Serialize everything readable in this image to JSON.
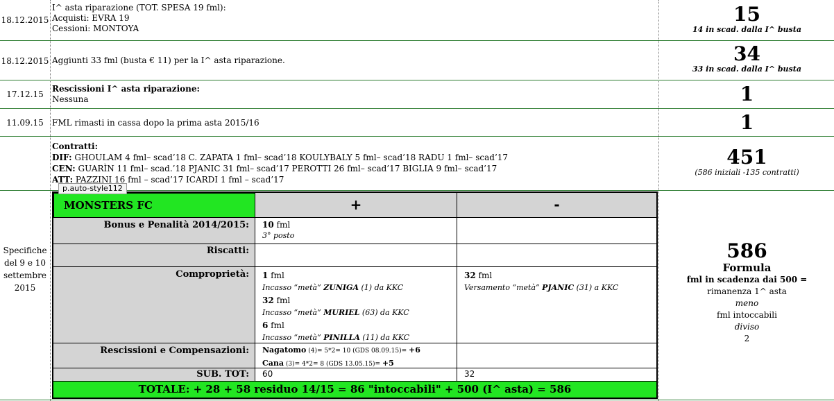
{
  "rows": [
    {
      "date": "18.12.2015",
      "lines": [
        "I^ asta riparazione (TOT. SPESA 19 fml):",
        "Acquisti: EVRA 19",
        "Cessioni: MONTOYA"
      ],
      "value": "15",
      "note": "14 in scad. dalla I^ busta"
    },
    {
      "date": "18.12.2015",
      "lines": [
        "Aggiunti 33 fml (busta € 11) per la I^ asta riparazione."
      ],
      "value": "34",
      "note": "33 in scad. dalla I^ busta"
    },
    {
      "date": "17.12.15",
      "title": "Rescissioni I^ asta riparazione:",
      "lines": [
        "Nessuna"
      ],
      "value": "1"
    },
    {
      "date": "11.09.15",
      "lines": [
        "FML rimasti in cassa dopo la prima asta 2015/16"
      ],
      "value": "1"
    }
  ],
  "contracts": {
    "title": "Contratti:",
    "dif_label": "DIF:",
    "dif": "GHOULAM 4 fml– scad’18  C. ZAPATA 1 fml– scad’18  KOULYBALY 5 fml– scad’18   RADU 1 fml– scad’17",
    "cen_label": "CEN:",
    "cen": "GUARÌN 11 fml– scad.’18  PJANIC 31 fml– scad’17  PEROTTI 26 fml– scad’17  BIGLIA 9 fml– scad’17",
    "att_label": "ATT:",
    "att": "PAZZINI 16 fml – scad’17  ICARDI 1 fml – scad’17",
    "value": "451",
    "note": "(586 iniziali -135 contratti)"
  },
  "tooltip": "p.auto-style112",
  "spec": {
    "date_lines": [
      "Specifiche",
      "del 9 e 10",
      "settembre",
      "2015"
    ],
    "value": "586",
    "formula_title": "Formula",
    "formula_bold": "fml in scadenza dai 500 =",
    "formula_lines": [
      "rimanenza 1^ asta",
      "meno",
      "fml intoccabili",
      "diviso",
      "2"
    ]
  },
  "table": {
    "team": "MONSTERS FC",
    "plus": "+",
    "minus": "-",
    "bonus_label": "Bonus e Penalità 2014/2015:",
    "bonus_val": "10",
    "bonus_unit": " fml",
    "bonus_note": "3° posto",
    "riscatti_label": "Riscatti:",
    "compro_label": "Comproprietà:",
    "compro_plus": [
      {
        "val": "1",
        "unit": " fml",
        "pre": "Incasso “metà” ",
        "name": "ZUNIGA",
        "post": " (1) da KKC"
      },
      {
        "val": "32",
        "unit": " fml",
        "pre": "Incasso “metà” ",
        "name": "MURIEL",
        "post": " (63) da KKC"
      },
      {
        "val": "6",
        "unit": " fml",
        "pre": "Incasso “metà” ",
        "name": "PINILLA",
        "post": " (11) da KKC"
      }
    ],
    "compro_minus": {
      "val": "32",
      "unit": " fml",
      "pre": "Versamento “metà” ",
      "name": "PJANIC",
      "post": " (31) a KKC"
    },
    "resc_label": "Rescissioni e Compensazioni:",
    "resc": [
      {
        "name": "Nagatomo",
        "detail": " (4)= 5*2= 10 (GDS 08.09.15)= ",
        "result": "+6"
      },
      {
        "name": "Cana",
        "detail": " (3)= 4*2= 8 (GDS 13.05.15)= ",
        "result": "+5"
      }
    ],
    "subtot_label": "SUB. TOT:",
    "subtot_plus": "60",
    "subtot_minus": "32",
    "total": "TOTALE: + 28 + 58 residuo 14/15 = 86 \"intoccabili\" + 500 (I^ asta) = 586"
  }
}
